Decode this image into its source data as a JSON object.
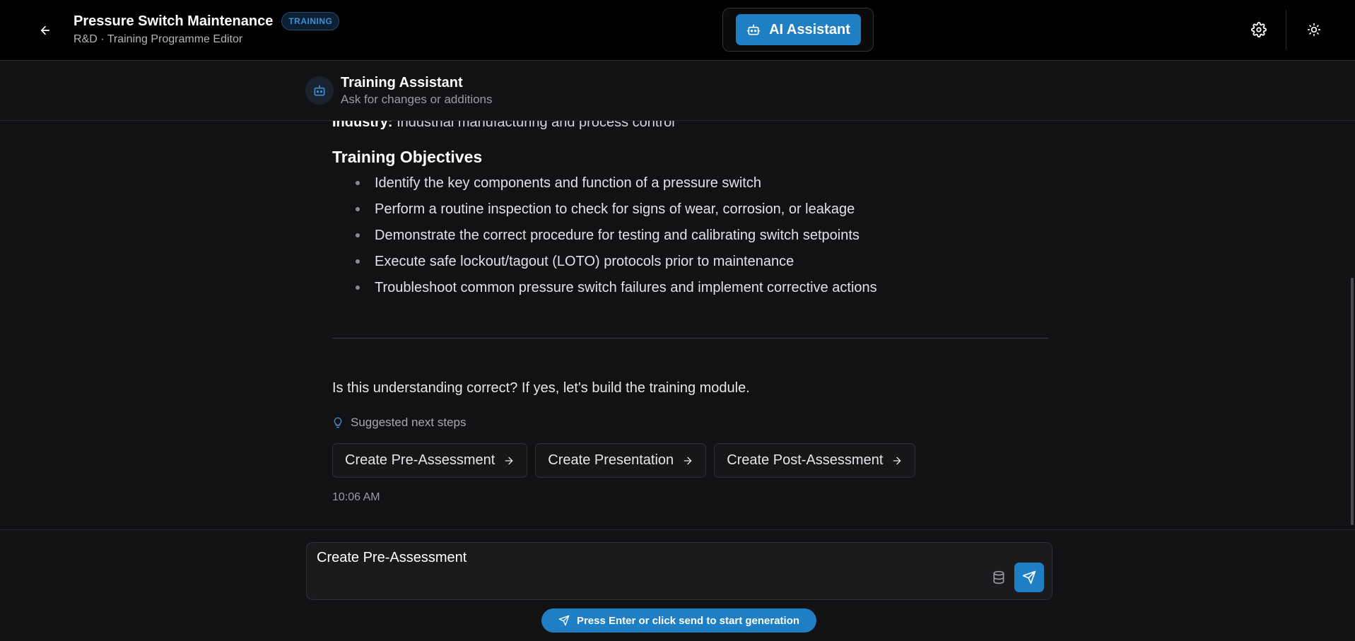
{
  "header": {
    "title": "Pressure Switch Maintenance",
    "badge": "TRAINING",
    "subtitle": "R&D · Training Programme Editor",
    "ai_button_label": "AI Assistant"
  },
  "assistant": {
    "name": "Training Assistant",
    "subtitle": "Ask for changes or additions"
  },
  "message": {
    "industry_label": "Industry:",
    "industry_value": "Industrial manufacturing and process control",
    "objectives_heading": "Training Objectives",
    "objectives": [
      "Identify the key components and function of a pressure switch",
      "Perform a routine inspection to check for signs of wear, corrosion, or leakage",
      "Demonstrate the correct procedure for testing and calibrating switch setpoints",
      "Execute safe lockout/tagout (LOTO) protocols prior to maintenance",
      "Troubleshoot common pressure switch failures and implement corrective actions"
    ],
    "question": "Is this understanding correct? If yes, let's build the training module.",
    "suggested_label": "Suggested next steps",
    "suggestions": [
      "Create Pre-Assessment",
      "Create Presentation",
      "Create Post-Assessment"
    ],
    "timestamp": "10:06 AM"
  },
  "input": {
    "value": "Create Pre-Assessment",
    "hint": "Press Enter or click send to start generation"
  },
  "colors": {
    "accent": "#1f7fc4",
    "background": "#121214",
    "topbar": "#000000"
  }
}
